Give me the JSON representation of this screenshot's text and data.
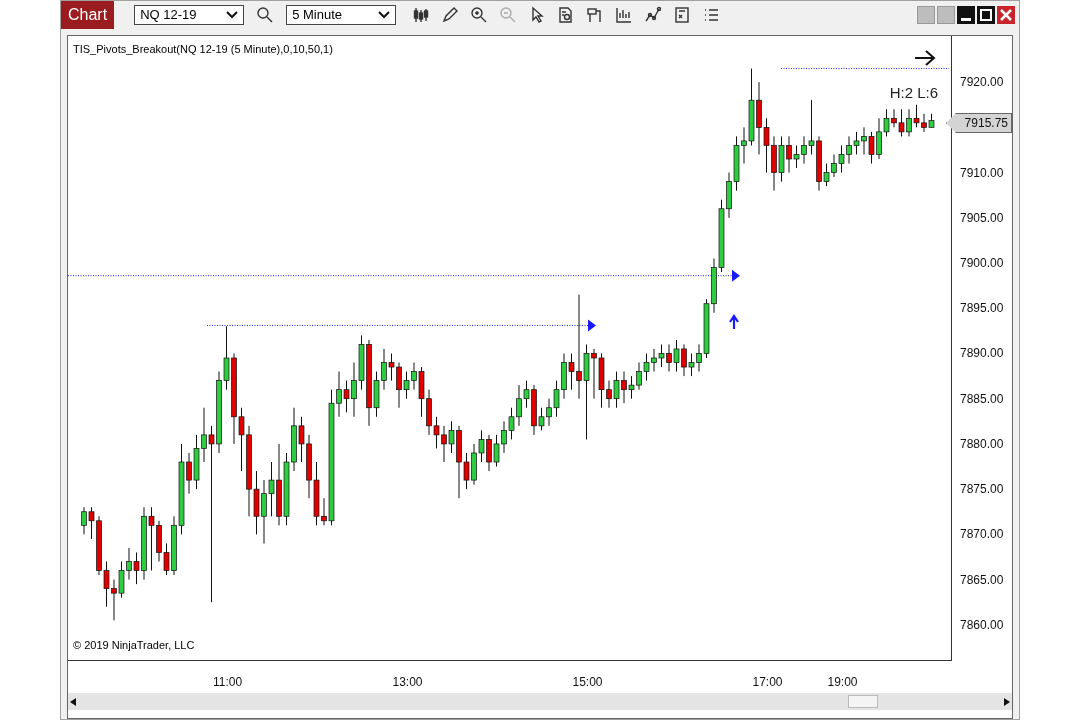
{
  "toolbar": {
    "title": "Chart",
    "instrument": "NQ 12-19",
    "interval": "5 Minute"
  },
  "chart": {
    "indicator_label": "TIS_Pivots_Breakout(NQ 12-19 (5 Minute),0,10,50,1)",
    "pivot_label": "H:2 L:6",
    "copyright": "© 2019 NinjaTrader, LLC",
    "current_price": "7915.75",
    "chart_data": {
      "type": "candlestick",
      "ylim": [
        7856,
        7925.1
      ],
      "categories": [
        null,
        null,
        null,
        null,
        null,
        null,
        null,
        null,
        null,
        null,
        null,
        null,
        null,
        null,
        null,
        null,
        null,
        null,
        null,
        "11:00",
        null,
        null,
        null,
        null,
        null,
        null,
        null,
        null,
        null,
        null,
        null,
        null,
        null,
        null,
        null,
        null,
        null,
        null,
        null,
        null,
        null,
        null,
        null,
        "13:00",
        null,
        null,
        null,
        null,
        null,
        null,
        null,
        null,
        null,
        null,
        null,
        null,
        null,
        null,
        null,
        null,
        null,
        null,
        null,
        null,
        null,
        null,
        null,
        "15:00",
        null,
        null,
        null,
        null,
        null,
        null,
        null,
        null,
        null,
        null,
        null,
        null,
        null,
        null,
        null,
        null,
        null,
        null,
        null,
        null,
        null,
        null,
        null,
        "17:00",
        null,
        null,
        null,
        null,
        null,
        null,
        null,
        null,
        null,
        "19:00",
        null,
        null,
        null,
        null,
        null,
        null,
        null,
        null,
        null,
        null,
        null,
        null
      ],
      "yticks": [
        {
          "value": 7920,
          "label": "7920.00"
        },
        {
          "value": 7910,
          "label": "7910.00"
        },
        {
          "value": 7905,
          "label": "7905.00"
        },
        {
          "value": 7900,
          "label": "7900.00"
        },
        {
          "value": 7895,
          "label": "7895.00"
        },
        {
          "value": 7890,
          "label": "7890.00"
        },
        {
          "value": 7885,
          "label": "7885.00"
        },
        {
          "value": 7880,
          "label": "7880.00"
        },
        {
          "value": 7875,
          "label": "7875.00"
        },
        {
          "value": 7870,
          "label": "7870.00"
        },
        {
          "value": 7865,
          "label": "7865.00"
        },
        {
          "value": 7860,
          "label": "7860.00"
        }
      ],
      "ohlc": [
        [
          7871,
          7873,
          7870,
          7872.5
        ],
        [
          7872.5,
          7873,
          7869.5,
          7871.5
        ],
        [
          7871.5,
          7872,
          7865.5,
          7866
        ],
        [
          7866,
          7867,
          7862,
          7864
        ],
        [
          7864,
          7865,
          7860.5,
          7863.5
        ],
        [
          7863.5,
          7867,
          7863,
          7866
        ],
        [
          7866,
          7868.5,
          7865,
          7867
        ],
        [
          7867,
          7868,
          7864.5,
          7866
        ],
        [
          7866,
          7873,
          7865,
          7872
        ],
        [
          7872,
          7873,
          7866,
          7871
        ],
        [
          7871,
          7871.5,
          7867,
          7868
        ],
        [
          7868,
          7869,
          7865.5,
          7866
        ],
        [
          7866,
          7872,
          7865.5,
          7871
        ],
        [
          7871,
          7880,
          7870,
          7878
        ],
        [
          7878,
          7879,
          7874.5,
          7876
        ],
        [
          7876,
          7881,
          7875,
          7879.5
        ],
        [
          7879.5,
          7884,
          7878,
          7881
        ],
        [
          7881,
          7882,
          7862.5,
          7880
        ],
        [
          7880,
          7888,
          7879,
          7887
        ],
        [
          7887,
          7893,
          7886,
          7889.5
        ],
        [
          7889.5,
          7890,
          7880,
          7883
        ],
        [
          7883,
          7884,
          7877,
          7881
        ],
        [
          7881,
          7882,
          7872,
          7875
        ],
        [
          7875,
          7877,
          7870,
          7872
        ],
        [
          7872,
          7876,
          7869,
          7874.5
        ],
        [
          7874.5,
          7878,
          7872,
          7876
        ],
        [
          7876,
          7880,
          7871,
          7872
        ],
        [
          7872,
          7879,
          7871,
          7878
        ],
        [
          7878,
          7884,
          7877,
          7882
        ],
        [
          7882,
          7883,
          7878,
          7880
        ],
        [
          7880,
          7881,
          7874,
          7876
        ],
        [
          7876,
          7878,
          7871,
          7872
        ],
        [
          7872,
          7874,
          7871,
          7871.5
        ],
        [
          7871.5,
          7886,
          7871,
          7884.5
        ],
        [
          7884.5,
          7888,
          7883,
          7886
        ],
        [
          7886,
          7887,
          7883.5,
          7885
        ],
        [
          7885,
          7889,
          7883,
          7887
        ],
        [
          7887,
          7892,
          7886,
          7891
        ],
        [
          7891,
          7891.5,
          7882,
          7884
        ],
        [
          7884,
          7888,
          7883,
          7887
        ],
        [
          7887,
          7890.5,
          7886,
          7889
        ],
        [
          7889,
          7890,
          7887,
          7888.5
        ],
        [
          7888.5,
          7889,
          7884,
          7886
        ],
        [
          7886,
          7888,
          7885,
          7887
        ],
        [
          7887,
          7889,
          7886,
          7888
        ],
        [
          7888,
          7888.5,
          7883,
          7885
        ],
        [
          7885,
          7886,
          7881,
          7882
        ],
        [
          7882,
          7883,
          7879.5,
          7881
        ],
        [
          7881,
          7882,
          7878,
          7880
        ],
        [
          7880,
          7882.5,
          7879,
          7881.5
        ],
        [
          7881.5,
          7882,
          7874,
          7878
        ],
        [
          7878,
          7879,
          7875,
          7876
        ],
        [
          7876,
          7880,
          7875.5,
          7879
        ],
        [
          7879,
          7881.5,
          7878,
          7880.5
        ],
        [
          7880.5,
          7881,
          7877,
          7878
        ],
        [
          7878,
          7881,
          7877.5,
          7880
        ],
        [
          7880,
          7882.5,
          7879,
          7881.5
        ],
        [
          7881.5,
          7884,
          7880.5,
          7883
        ],
        [
          7883,
          7886.5,
          7882,
          7885
        ],
        [
          7885,
          7887,
          7884,
          7886
        ],
        [
          7886,
          7886.5,
          7881,
          7882
        ],
        [
          7882,
          7884,
          7881.5,
          7883
        ],
        [
          7883,
          7885,
          7882,
          7884
        ],
        [
          7884,
          7887,
          7883,
          7886
        ],
        [
          7886,
          7890,
          7885,
          7889
        ],
        [
          7889,
          7890,
          7886,
          7888
        ],
        [
          7888,
          7896.5,
          7885,
          7887
        ],
        [
          7887,
          7891,
          7880.5,
          7890
        ],
        [
          7890,
          7890.5,
          7885,
          7889.5
        ],
        [
          7889.5,
          7890,
          7884,
          7886
        ],
        [
          7886,
          7887,
          7884,
          7885
        ],
        [
          7885,
          7888,
          7884,
          7887
        ],
        [
          7887,
          7888,
          7884.5,
          7886
        ],
        [
          7886,
          7887.5,
          7885,
          7886.5
        ],
        [
          7886.5,
          7889,
          7886,
          7888
        ],
        [
          7888,
          7890,
          7887,
          7889
        ],
        [
          7889,
          7890.5,
          7888,
          7889.5
        ],
        [
          7889.5,
          7891,
          7888.5,
          7890
        ],
        [
          7890,
          7891,
          7888,
          7889
        ],
        [
          7889,
          7891.5,
          7888,
          7890.5
        ],
        [
          7890.5,
          7891,
          7887.5,
          7888.5
        ],
        [
          7888.5,
          7890,
          7887.5,
          7889
        ],
        [
          7889,
          7891,
          7888,
          7890
        ],
        [
          7890,
          7896,
          7889.5,
          7895.5
        ],
        [
          7895.5,
          7900.5,
          7894.5,
          7899.5
        ],
        [
          7899.5,
          7907,
          7899,
          7906
        ],
        [
          7906,
          7910,
          7905,
          7909
        ],
        [
          7909,
          7914,
          7908,
          7913
        ],
        [
          7913,
          7915,
          7911,
          7913.5
        ],
        [
          7913.5,
          7921.5,
          7913,
          7918
        ],
        [
          7918,
          7920,
          7912,
          7915
        ],
        [
          7915,
          7916,
          7910,
          7913
        ],
        [
          7913,
          7914,
          7908,
          7910
        ],
        [
          7910,
          7914,
          7909,
          7913
        ],
        [
          7913,
          7914,
          7910,
          7911.5
        ],
        [
          7911.5,
          7913,
          7910.5,
          7912
        ],
        [
          7912,
          7914,
          7911,
          7913
        ],
        [
          7913,
          7918,
          7912,
          7913.5
        ],
        [
          7913.5,
          7914,
          7908,
          7909
        ],
        [
          7909,
          7911,
          7908.5,
          7910
        ],
        [
          7910,
          7912,
          7909.5,
          7911
        ],
        [
          7911,
          7913,
          7910,
          7912
        ],
        [
          7912,
          7914,
          7911,
          7913
        ],
        [
          7913,
          7914.5,
          7912,
          7913.5
        ],
        [
          7913.5,
          7915,
          7912,
          7914
        ],
        [
          7914,
          7914.5,
          7911,
          7912
        ],
        [
          7912,
          7916,
          7911.5,
          7914.5
        ],
        [
          7914.5,
          7917,
          7914,
          7916
        ],
        [
          7916,
          7917,
          7915,
          7915.5
        ],
        [
          7915.5,
          7917,
          7914,
          7914.5
        ],
        [
          7914.5,
          7917,
          7914,
          7916
        ],
        [
          7916,
          7917.5,
          7915,
          7915.5
        ],
        [
          7915.5,
          7916.5,
          7914.5,
          7915
        ],
        [
          7915,
          7916.5,
          7915,
          7915.75
        ]
      ]
    }
  }
}
